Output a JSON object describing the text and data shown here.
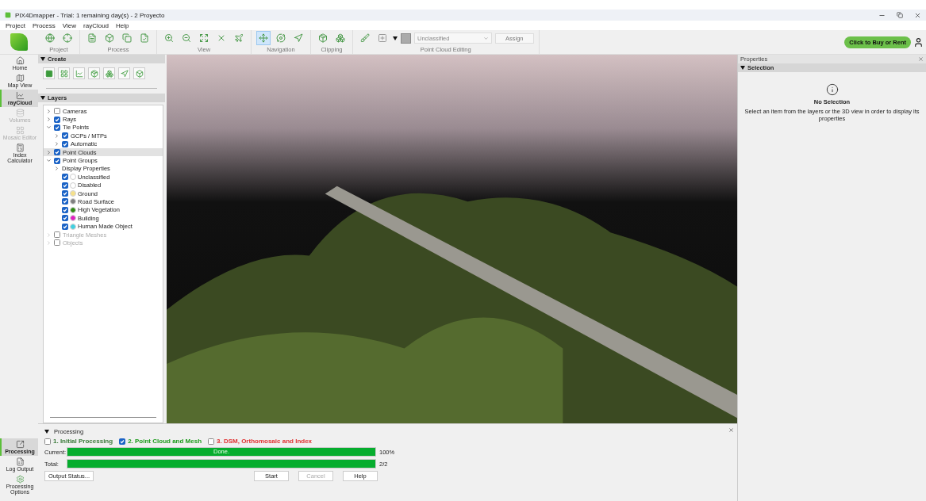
{
  "window": {
    "title": "PIX4Dmapper - Trial: 1 remaining day(s) - 2 Proyecto"
  },
  "menu": [
    "Project",
    "Process",
    "View",
    "rayCloud",
    "Help"
  ],
  "toolbar": {
    "groups": [
      {
        "label": "Project",
        "tools": [
          {
            "selected": false
          },
          {
            "selected": false
          }
        ]
      },
      {
        "label": "Process",
        "tools": [
          {
            "selected": false
          },
          {
            "selected": false
          },
          {
            "selected": false
          },
          {
            "selected": false
          }
        ]
      },
      {
        "label": "View",
        "tools": [
          {
            "selected": false
          },
          {
            "selected": false
          },
          {
            "selected": false
          },
          {
            "selected": false
          },
          {
            "selected": false
          }
        ]
      },
      {
        "label": "Navigation",
        "tools": [
          {
            "selected": true
          },
          {
            "selected": false
          },
          {
            "selected": false
          }
        ]
      },
      {
        "label": "Clipping",
        "tools": [
          {
            "selected": false
          },
          {
            "selected": false
          }
        ]
      }
    ],
    "editing": {
      "label": "Point Cloud Editing",
      "class_select": "Unclassified",
      "assign": "Assign"
    },
    "buy": "Click to Buy or Rent"
  },
  "rail": [
    {
      "label": "Home",
      "selected": false,
      "disabled": false
    },
    {
      "label": "Map View",
      "selected": false,
      "disabled": false
    },
    {
      "label": "rayCloud",
      "selected": true,
      "disabled": false
    },
    {
      "label": "Volumes",
      "selected": false,
      "disabled": true
    },
    {
      "label": "Mosaic Editor",
      "selected": false,
      "disabled": true
    },
    {
      "label": "Index Calculator",
      "selected": false,
      "disabled": false
    }
  ],
  "rail_bottom": [
    {
      "label": "Processing",
      "selected": true
    },
    {
      "label": "Log Output",
      "selected": false
    },
    {
      "label": "Processing Options",
      "selected": false
    }
  ],
  "create": {
    "title": "Create"
  },
  "layers": {
    "title": "Layers",
    "items": [
      {
        "kind": "group",
        "label": "Cameras",
        "checked": false,
        "expanded": false,
        "disabled": false,
        "selected": false
      },
      {
        "kind": "group",
        "label": "Rays",
        "checked": true,
        "expanded": false,
        "disabled": false,
        "selected": false
      },
      {
        "kind": "group",
        "label": "Tie Points",
        "checked": true,
        "expanded": true,
        "disabled": false,
        "selected": false,
        "children": [
          {
            "kind": "group",
            "label": "GCPs / MTPs",
            "checked": true,
            "expanded": false,
            "disabled": false,
            "selected": false
          },
          {
            "kind": "group",
            "label": "Automatic",
            "checked": true,
            "expanded": false,
            "disabled": false,
            "selected": false
          }
        ]
      },
      {
        "kind": "group",
        "label": "Point Clouds",
        "checked": true,
        "expanded": false,
        "disabled": false,
        "selected": true
      },
      {
        "kind": "group",
        "label": "Point Groups",
        "checked": true,
        "expanded": true,
        "disabled": false,
        "selected": false,
        "children": [
          {
            "kind": "folder",
            "label": "Display Properties",
            "expanded": false,
            "selected": false
          },
          {
            "kind": "class",
            "label": "Unclassified",
            "checked": true,
            "color": "#ffffff",
            "selected": false
          },
          {
            "kind": "class",
            "label": "Disabled",
            "checked": true,
            "color": "#ffffff",
            "selected": false
          },
          {
            "kind": "class",
            "label": "Ground",
            "checked": true,
            "color": "#f5e08a",
            "selected": false
          },
          {
            "kind": "class",
            "label": "Road Surface",
            "checked": true,
            "color": "#808080",
            "selected": false
          },
          {
            "kind": "class",
            "label": "High Vegetation",
            "checked": true,
            "color": "#2e8b12",
            "selected": false
          },
          {
            "kind": "class",
            "label": "Building",
            "checked": true,
            "color": "#e020c0",
            "selected": false
          },
          {
            "kind": "class",
            "label": "Human Made Object",
            "checked": true,
            "color": "#40d0e0",
            "selected": false
          }
        ]
      },
      {
        "kind": "group",
        "label": "Triangle Meshes",
        "checked": false,
        "expanded": false,
        "disabled": true,
        "selected": false
      },
      {
        "kind": "group",
        "label": "Objects",
        "checked": false,
        "expanded": false,
        "disabled": true,
        "selected": false
      }
    ]
  },
  "properties": {
    "title": "Properties",
    "section": "Selection",
    "empty_title": "No Selection",
    "empty_text": "Select an item from the layers or the 3D view in order to display its properties"
  },
  "processing": {
    "title": "Processing",
    "steps": [
      {
        "label": "1. Initial Processing",
        "checked": false,
        "color": "#3a7a3a"
      },
      {
        "label": "2. Point Cloud and Mesh",
        "checked": true,
        "color": "#1a9a1a"
      },
      {
        "label": "3. DSM, Orthomosaic and Index",
        "checked": false,
        "color": "#e03030"
      }
    ],
    "bars": [
      {
        "label": "Current:",
        "text": "Done.",
        "level": 1,
        "reading": "100%"
      },
      {
        "label": "Total:",
        "level": 1,
        "reading": "2/2"
      }
    ],
    "buttons": [
      {
        "label": "Start",
        "disabled": false
      },
      {
        "label": "Cancel",
        "disabled": true
      },
      {
        "label": "Help",
        "disabled": false
      }
    ],
    "output_status": "Output Status..."
  }
}
